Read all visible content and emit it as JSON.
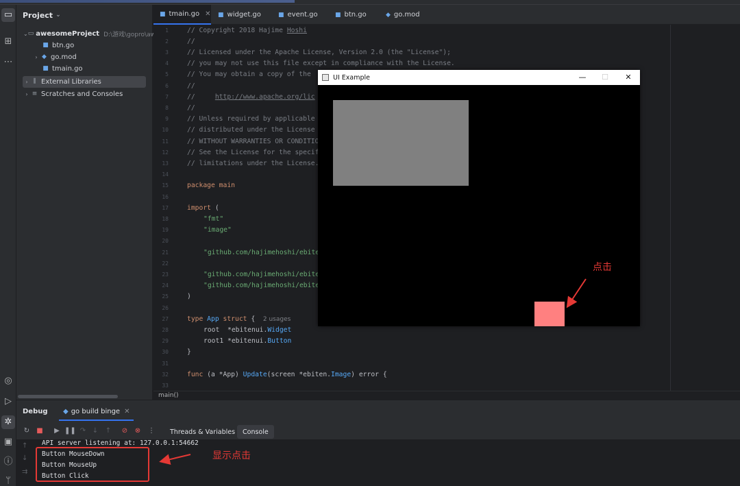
{
  "project_panel": {
    "title": "Project",
    "tree": [
      {
        "name": "awesomeProject",
        "path": "D:\\游戏\\gopro\\awe"
      },
      {
        "name": "btn.go"
      },
      {
        "name": "go.mod"
      },
      {
        "name": "tmain.go"
      },
      {
        "name": "External Libraries"
      },
      {
        "name": "Scratches and Consoles"
      }
    ]
  },
  "tabs": [
    {
      "label": "tmain.go",
      "active": true
    },
    {
      "label": "widget.go"
    },
    {
      "label": "event.go"
    },
    {
      "label": "btn.go"
    },
    {
      "label": "go.mod"
    }
  ],
  "editor": {
    "line_numbers": [
      "1",
      "2",
      "3",
      "4",
      "5",
      "6",
      "7",
      "8",
      "9",
      "10",
      "11",
      "12",
      "13",
      "14",
      "15",
      "16",
      "17",
      "18",
      "19",
      "20",
      "21",
      "22",
      "23",
      "24",
      "25",
      "26",
      "27",
      "28",
      "29",
      "30",
      "31",
      "32",
      "33"
    ],
    "lines": {
      "l1": "// Copyright 2018 Hajime ",
      "l1b": "Hoshi",
      "l2": "//",
      "l3": "// Licensed under the Apache License, Version 2.0 (the \"License\");",
      "l4": "// you may not use this file except in compliance with the License.",
      "l5": "// You may obtain a copy of the",
      "l6": "//",
      "l7": "//     ",
      "l7b": "http://www.apache.org/lic",
      "l8": "//",
      "l9": "// Unless required by applicable",
      "l10": "// distributed under the License",
      "l11": "// WITHOUT WARRANTIES OR CONDITIO",
      "l12": "// See the License for the specif",
      "l13": "// limitations under the License.",
      "l15a": "package ",
      "l15b": "main",
      "l17a": "import",
      "l17b": " (",
      "l18": "\"fmt\"",
      "l19": "\"image\"",
      "l21": "\"github.com/hajimehoshi/ebite",
      "l23": "\"github.com/hajimehoshi/ebite",
      "l24": "\"github.com/hajimehoshi/ebite",
      "l25": ")",
      "l27a": "type ",
      "l27b": "App ",
      "l27c": "struct",
      "l27d": " {  ",
      "l27hint": "2 usages",
      "l28a": "root  *ebitenui.",
      "l28b": "Widget",
      "l29a": "root1 *ebitenui.",
      "l29b": "Button",
      "l30": "}",
      "l32a": "func",
      "l32b": " (a *App) ",
      "l32c": "Update",
      "l32d": "(screen *ebiten.",
      "l32e": "Image",
      "l32f": ") error {"
    }
  },
  "breadcrumb": "main()",
  "debug": {
    "title": "Debug",
    "session_tab": "go build binge",
    "subtabs": [
      "Threads & Variables",
      "Console"
    ],
    "console_lines": [
      "API server listening at: 127.0.0.1:54662",
      "Button MouseDown",
      "Button MouseUp",
      "Button Click"
    ]
  },
  "app_window": {
    "title": "UI Example",
    "minimize": "—",
    "maximize": "☐",
    "close": "✕"
  },
  "annotations": {
    "click_label": "点击",
    "show_click_label": "显示点击"
  },
  "colors": {
    "accent": "#3574f0",
    "annotation": "#e53935",
    "widget_gray": "#808080",
    "button_pink": "#ff8080"
  }
}
